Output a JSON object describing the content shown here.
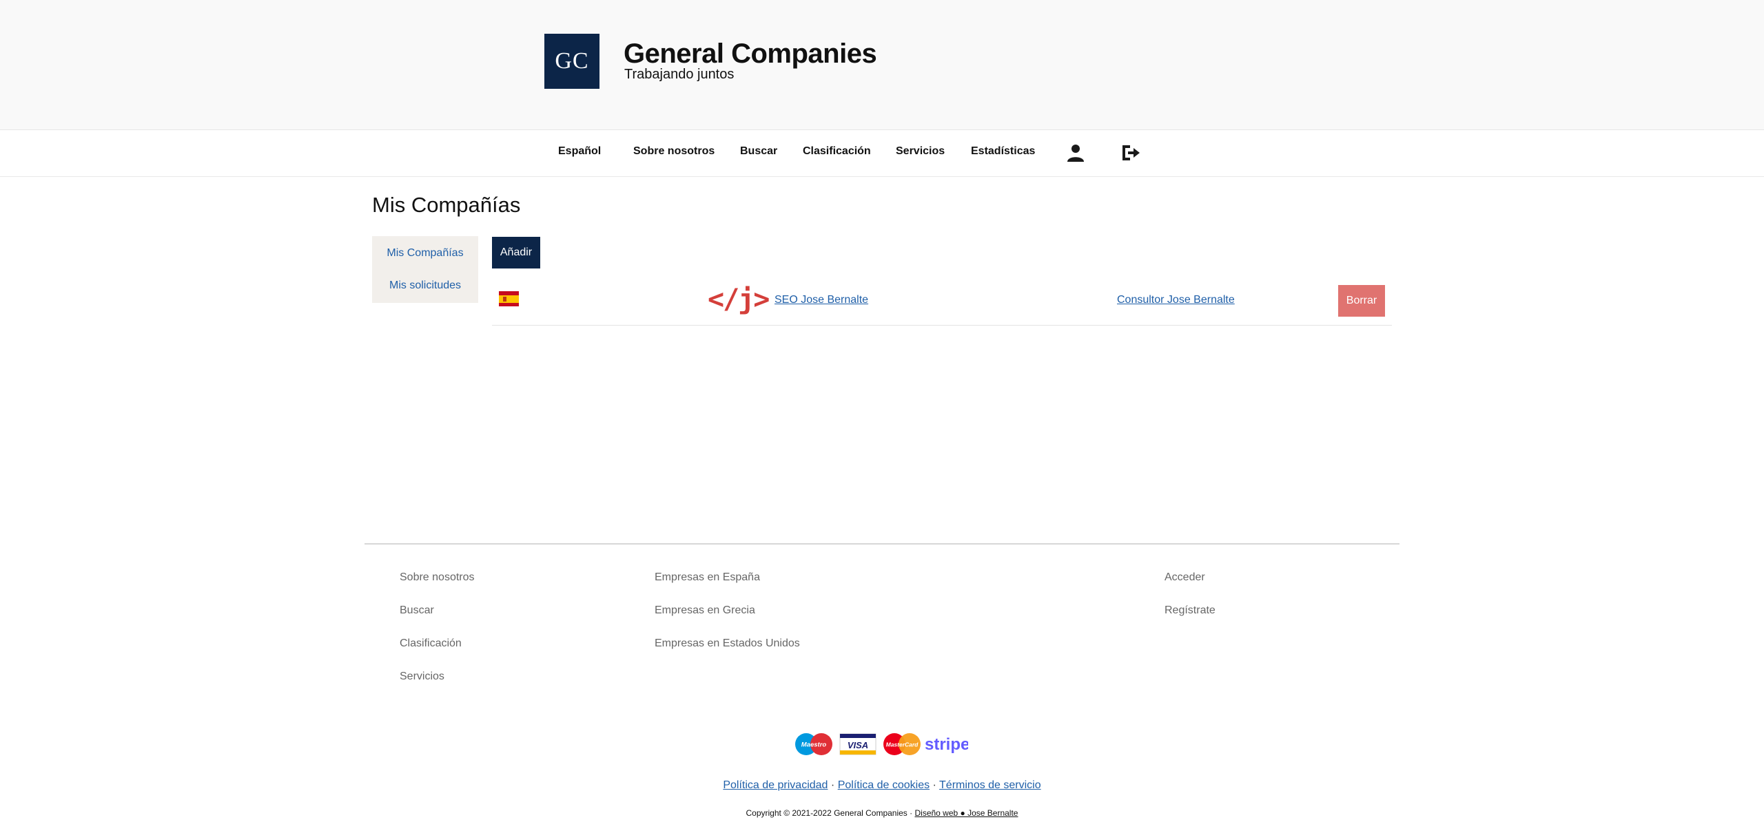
{
  "header": {
    "logo_text": "GC",
    "title": "General Companies",
    "subtitle": "Trabajando juntos"
  },
  "nav": {
    "items": [
      "Español",
      "Sobre nosotros",
      "Buscar",
      "Clasificación",
      "Servicios",
      "Estadísticas"
    ],
    "icons": [
      "user-icon",
      "logout-icon"
    ]
  },
  "main": {
    "title": "Mis Compañías",
    "sidebar": [
      "Mis Compañías",
      "Mis solicitudes"
    ],
    "add_label": "Añadir",
    "rows": [
      {
        "flag": "spain-flag-icon",
        "logo_text": "</j>",
        "company": "SEO Jose Bernalte",
        "consultor": "Consultor Jose Bernalte",
        "delete_label": "Borrar"
      }
    ]
  },
  "footer": {
    "col1": [
      "Sobre nosotros",
      "Buscar",
      "Clasificación",
      "Servicios"
    ],
    "col2": [
      "Empresas en España",
      "Empresas en Grecia",
      "Empresas en Estados Unidos"
    ],
    "col3": [
      "Acceder",
      "Regístrate"
    ],
    "payments": {
      "maestro": "Maestro",
      "visa": "VISA",
      "mastercard": "MasterCard",
      "stripe": "stripe"
    },
    "legal": [
      "Política de privacidad",
      "Política de cookies",
      "Términos de servicio"
    ],
    "separator": "·",
    "copyright": "Copyright © 2021-2022 General Companies ·",
    "design_link": "Diseño web ● Jose Bernalte"
  },
  "colors": {
    "navy": "#0c2548",
    "danger": "#e07370",
    "link": "#1f5fa8",
    "accent_red": "#d43f3a"
  }
}
